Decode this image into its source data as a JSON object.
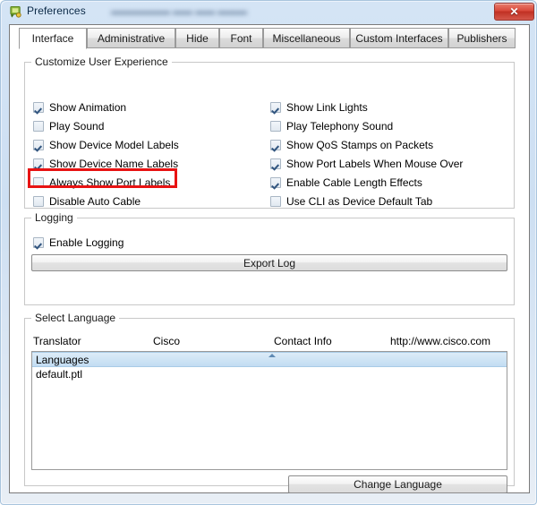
{
  "window": {
    "title": "Preferences",
    "title_blurred_text": "▬▬▬▬▬▬ ▬▬ ▬▬ ▬▬▬▬",
    "icon": "preferences-app-icon",
    "close_label": "✕",
    "close_icon": "close-icon"
  },
  "tabs": [
    {
      "label": "Interface",
      "active": true
    },
    {
      "label": "Administrative",
      "active": false
    },
    {
      "label": "Hide",
      "active": false
    },
    {
      "label": "Font",
      "active": false
    },
    {
      "label": "Miscellaneous",
      "active": false
    },
    {
      "label": "Custom Interfaces",
      "active": false
    },
    {
      "label": "Publishers",
      "active": false
    }
  ],
  "customize_group": {
    "title": "Customize User Experience",
    "left_column": [
      {
        "label": "Show Animation",
        "checked": true,
        "highlighted": false
      },
      {
        "label": "Play Sound",
        "checked": false,
        "highlighted": false
      },
      {
        "label": "Show Device Model Labels",
        "checked": true,
        "highlighted": false
      },
      {
        "label": "Show Device Name Labels",
        "checked": true,
        "highlighted": false
      },
      {
        "label": "Always Show Port Labels",
        "checked": false,
        "highlighted": true
      },
      {
        "label": "Disable Auto Cable",
        "checked": false,
        "highlighted": false
      }
    ],
    "right_column": [
      {
        "label": "Show Link Lights",
        "checked": true
      },
      {
        "label": "Play Telephony Sound",
        "checked": false
      },
      {
        "label": "Show QoS Stamps on Packets",
        "checked": true
      },
      {
        "label": "Show Port Labels When Mouse Over",
        "checked": true
      },
      {
        "label": "Enable Cable Length Effects",
        "checked": true
      },
      {
        "label": "Use CLI as Device Default Tab",
        "checked": false
      }
    ]
  },
  "logging_group": {
    "title": "Logging",
    "enable_logging": {
      "label": "Enable Logging",
      "checked": true
    },
    "export_button": "Export Log"
  },
  "language_group": {
    "title": "Select Language",
    "headers": {
      "translator": "Translator",
      "vendor": "Cisco",
      "contact_info": "Contact Info",
      "url": "http://www.cisco.com"
    },
    "list_items": [
      {
        "label": "Languages",
        "selected": true
      },
      {
        "label": "default.ptl",
        "selected": false
      }
    ],
    "sort_icon": "sort-ascending-icon",
    "change_button": "Change Language"
  },
  "colors": {
    "accent_red": "#e81313",
    "selection_blue": "#cfe4f5",
    "titlebar_blue": "#cddff2"
  }
}
